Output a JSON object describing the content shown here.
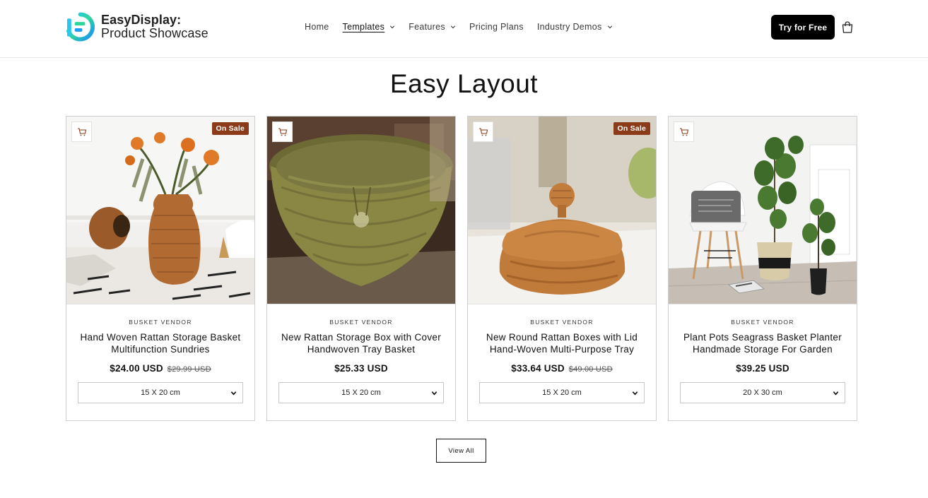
{
  "header": {
    "logo_line1": "EasyDisplay:",
    "logo_line2": "Product Showcase",
    "nav": [
      {
        "label": "Home",
        "dropdown": false,
        "active": false
      },
      {
        "label": "Templates",
        "dropdown": true,
        "active": true
      },
      {
        "label": "Features",
        "dropdown": true,
        "active": false
      },
      {
        "label": "Pricing Plans",
        "dropdown": false,
        "active": false
      },
      {
        "label": "Industry Demos",
        "dropdown": true,
        "active": false
      }
    ],
    "cta_label": "Try for Free",
    "cart_icon": "cart-bag-icon"
  },
  "section": {
    "title": "Easy Layout"
  },
  "products": [
    {
      "vendor": "BUSKET VENDOR",
      "title": "Hand Woven Rattan Storage Basket Multifunction Sundries",
      "price": "$24.00 USD",
      "compare_price": "$29.99 USD",
      "badge": "On Sale",
      "variant": "15 X 20 cm",
      "image": "rattan-vase-with-sunflowers"
    },
    {
      "vendor": "BUSKET VENDOR",
      "title": "New Rattan Storage Box with Cover Handwoven Tray Basket",
      "price": "$25.33 USD",
      "compare_price": "",
      "badge": "",
      "variant": "15 X 20 cm",
      "image": "green-seagrass-basket"
    },
    {
      "vendor": "BUSKET VENDOR",
      "title": "New Round Rattan Boxes with Lid Hand-Woven Multi-Purpose Tray",
      "price": "$33.64 USD",
      "compare_price": "$49.00 USD",
      "badge": "On Sale",
      "variant": "15 X 20 cm",
      "image": "rattan-box-with-lid"
    },
    {
      "vendor": "BUSKET VENDOR",
      "title": "Plant Pots Seagrass Basket Planter Handmade Storage For Garden",
      "price": "$39.25 USD",
      "compare_price": "",
      "badge": "",
      "variant": "20 X 30 cm",
      "image": "room-with-chair-and-plants"
    }
  ],
  "view_all_label": "View All",
  "colors": {
    "accent": "#000000",
    "sale_badge": "#8b3a1a",
    "text": "#121212",
    "border": "#cfcfcf"
  }
}
